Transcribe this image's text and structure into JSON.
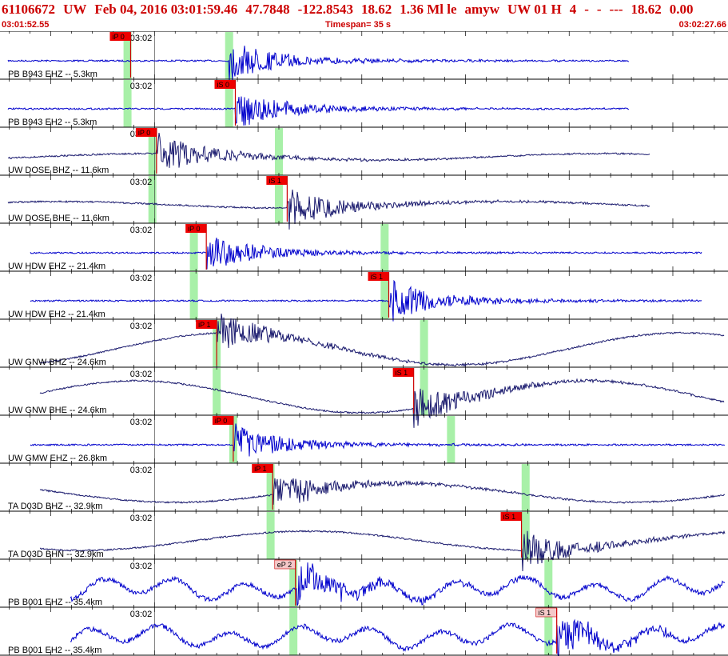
{
  "header": {
    "title_parts": [
      "61106672",
      "UW",
      "Feb 04, 2016 03:01:59.46",
      "47.7848",
      "-122.8543",
      "18.62",
      "1.36 Ml le",
      "amyw",
      "UW 01 H",
      "4",
      "-",
      "-",
      "---",
      "18.62",
      "0.00"
    ],
    "start_time": "03:01:52.55",
    "timespan": "Timespan=  35 s",
    "end_time": "03:02:27.66"
  },
  "colors": {
    "header_text": "#cc0000",
    "trace_blue": "#0000cc",
    "trace_dark": "#1a1a6e",
    "pick_fill": "#ee0000",
    "pick_fill_light": "#f4c8c8",
    "window_green": "#a8f0a8"
  },
  "time_axis": {
    "start_seconds": 52.55,
    "end_seconds": 87.66,
    "tick_label": "03:02"
  },
  "channels": [
    {
      "label": "PB B943 EHZ -- 5.3km",
      "trace_color": "blue",
      "pick": "iP 0",
      "pick_style": "solid",
      "pick_time": 58.85,
      "window_times": [
        58.7,
        63.6
      ],
      "onset": 63.6,
      "end_time": 82.9
    },
    {
      "label": "PB B943 EH2 -- 5.3km",
      "trace_color": "blue",
      "pick": "iS 0",
      "pick_style": "solid",
      "pick_time": 63.9,
      "window_times": [
        58.7,
        63.6
      ],
      "onset": 63.9,
      "end_time": 82.9
    },
    {
      "label": "UW DOSE BHZ -- 11.6km",
      "trace_color": "dark",
      "pick": "iP 0",
      "pick_style": "solid",
      "pick_time": 60.1,
      "window_times": [
        59.9,
        66.0
      ],
      "onset": 60.1,
      "end_time": 83.9
    },
    {
      "label": "UW DOSE BHE -- 11.6km",
      "trace_color": "dark",
      "pick": "iS 1",
      "pick_style": "solid",
      "pick_time": 66.4,
      "window_times": [
        59.9,
        66.0
      ],
      "onset": 66.4,
      "end_time": 83.9
    },
    {
      "label": "UW HDW EHZ -- 21.4km",
      "trace_color": "blue",
      "pick": "iP 0",
      "pick_style": "solid",
      "pick_time": 62.5,
      "window_times": [
        61.9,
        71.1
      ],
      "onset": 62.5,
      "end_time": 86.4
    },
    {
      "label": "UW HDW EH2 -- 21.4km",
      "trace_color": "blue",
      "pick": "iS 1",
      "pick_style": "solid",
      "pick_time": 71.3,
      "window_times": [
        61.9,
        71.1
      ],
      "onset": 71.3,
      "end_time": 86.4
    },
    {
      "label": "UW GNW BHZ -- 24.6km",
      "trace_color": "dark",
      "pick": "iP 1",
      "pick_style": "solid",
      "pick_time": 63.0,
      "window_times": [
        63.0,
        73.0
      ],
      "onset": 63.0,
      "end_time": 87.5
    },
    {
      "label": "UW GNW BHE -- 24.6km",
      "trace_color": "dark",
      "pick": "iS 1",
      "pick_style": "solid",
      "pick_time": 72.5,
      "window_times": [
        63.0,
        73.0
      ],
      "onset": 72.5,
      "end_time": 87.5
    },
    {
      "label": "UW GMW EHZ -- 26.8km",
      "trace_color": "blue",
      "pick": "iP 0",
      "pick_style": "solid",
      "pick_time": 63.8,
      "window_times": [
        63.8,
        74.3
      ],
      "onset": 63.8,
      "end_time": 87.9
    },
    {
      "label": "TA D03D BHZ -- 32.9km",
      "trace_color": "dark",
      "pick": "iP 1",
      "pick_style": "solid",
      "pick_time": 65.7,
      "window_times": [
        65.6,
        77.9
      ],
      "onset": 65.7,
      "end_time": 87.8
    },
    {
      "label": "TA D03D BHN -- 32.9km",
      "trace_color": "dark",
      "pick": "iS 1",
      "pick_style": "solid",
      "pick_time": 77.7,
      "window_times": [
        65.6,
        77.9
      ],
      "onset": 77.7,
      "end_time": 87.8
    },
    {
      "label": "PB B001 EHZ -- 35.4km",
      "trace_color": "blue",
      "pick": "eP 2",
      "pick_style": "light",
      "pick_time": 66.8,
      "window_times": [
        66.7,
        79.0
      ],
      "onset": 66.8,
      "end_time": 87.66
    },
    {
      "label": "PB B001 EH2 -- 35.4km",
      "trace_color": "blue",
      "pick": "iS 1",
      "pick_style": "light",
      "pick_time": 79.4,
      "window_times": [
        66.7,
        79.0
      ],
      "onset": 79.4,
      "end_time": 87.66
    }
  ]
}
